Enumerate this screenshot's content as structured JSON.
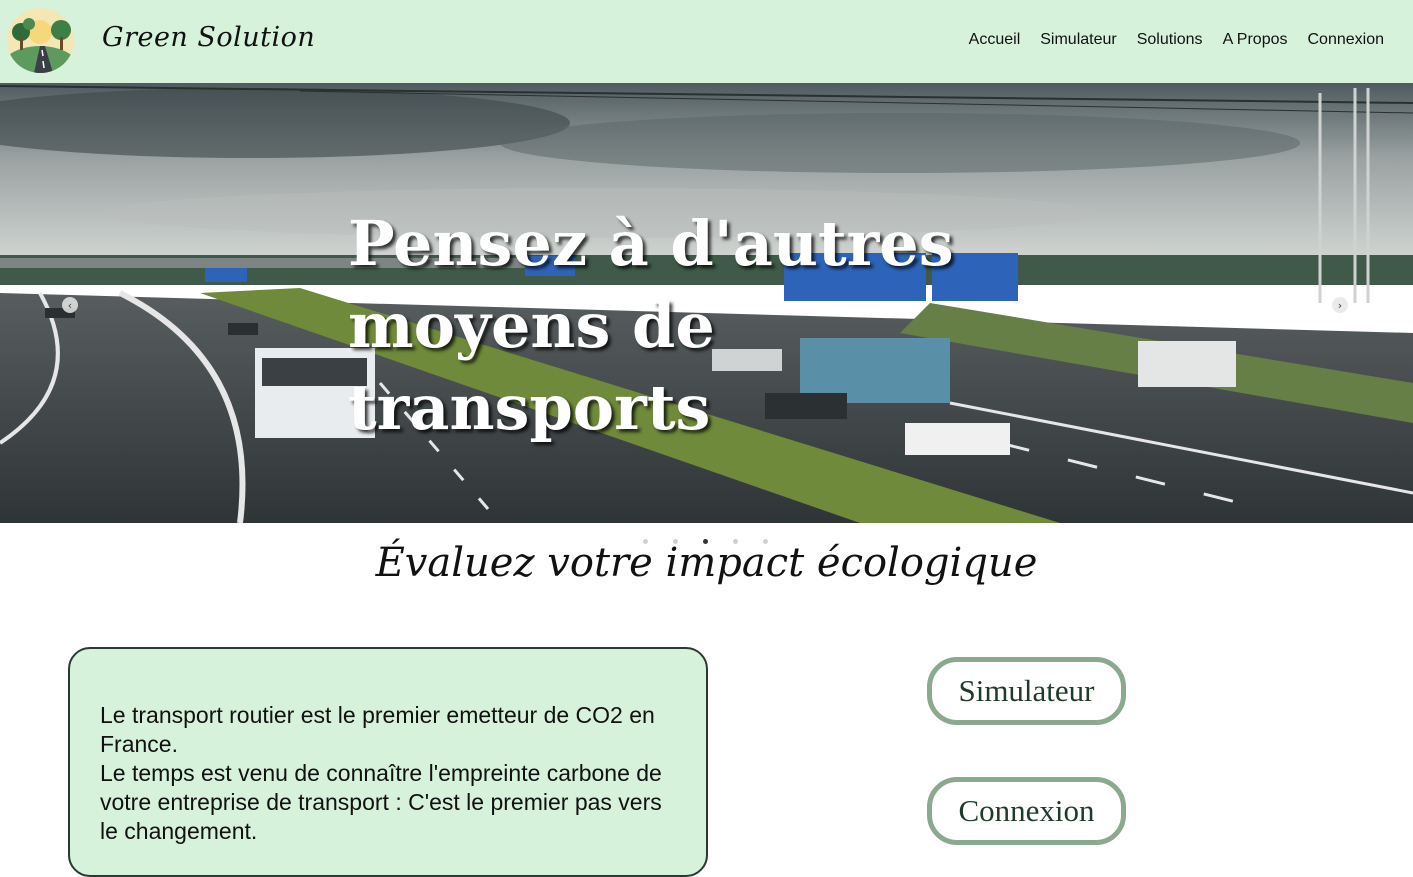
{
  "header": {
    "brand": "Green Solution",
    "nav": [
      "Accueil",
      "Simulateur",
      "Solutions",
      "A Propos",
      "Connexion"
    ]
  },
  "hero": {
    "title_line1": "Pensez à d'autres",
    "title_line2": "moyens de transports",
    "slide_count": 5,
    "active_slide": 3
  },
  "main": {
    "section_title": "Évaluez votre impact écologique",
    "paragraph1": "Le transport routier est le premier emetteur de CO2 en France.",
    "paragraph2": "Le temps est venu de connaître l'empreinte carbone de votre entreprise de transport : C'est le premier pas vers le changement.",
    "button_simulateur": "Simulateur",
    "button_connexion": "Connexion"
  },
  "colors": {
    "header_bg": "#d7f2db",
    "pill_border": "#8aa98e",
    "box_border": "#2a3a30"
  }
}
